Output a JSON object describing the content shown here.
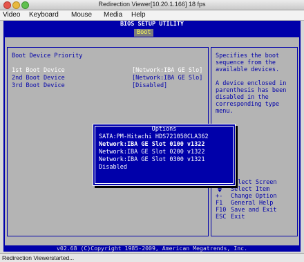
{
  "window": {
    "title": "Redirection Viewer[10.20.1.166]  18 fps"
  },
  "menu": [
    "Video",
    "Keyboard",
    "Mouse",
    "Media",
    "Help"
  ],
  "bios": {
    "header": "BIOS SETUP UTILITY",
    "active_tab": "Boot",
    "section_title": "Boot Device Priority",
    "devices": [
      {
        "label": "1st Boot Device",
        "value": "[Network:IBA GE Slo]"
      },
      {
        "label": "2nd Boot Device",
        "value": "[Network:IBA GE Slo]"
      },
      {
        "label": "3rd Boot Device",
        "value": "[Disabled]"
      }
    ],
    "help_text": [
      "Specifies the boot",
      "sequence from the",
      "available devices.",
      "",
      "A device enclosed in",
      "parenthesis has been",
      "disabled in the",
      "corresponding type",
      "menu."
    ],
    "keys": [
      {
        "key": "",
        "desc": "Select Screen"
      },
      {
        "key": "",
        "desc": "Select Item"
      },
      {
        "key": "+-",
        "desc": "Change Option"
      },
      {
        "key": "F1",
        "desc": "General Help"
      },
      {
        "key": "F10",
        "desc": "Save and Exit"
      },
      {
        "key": "ESC",
        "desc": "Exit"
      }
    ],
    "options_popup": {
      "title": "Options",
      "items": [
        "SATA:PM-Hitachi HDS721050CLA362",
        "Network:IBA GE Slot 0100 v1322",
        "Network:IBA GE Slot 0200 v1322",
        "Network:IBA GE Slot 0300 v1321",
        "Disabled"
      ],
      "selected_index": 1
    },
    "copyright": "v02.68 (C)Copyright 1985-2009, American Megatrends, Inc."
  },
  "status_bar": {
    "text": "Redirection Viewerstarted..."
  },
  "colors": {
    "bios_blue": "#0000aa",
    "bios_gray": "#b4b4b4",
    "highlight_yellow": "#ffff5a"
  }
}
